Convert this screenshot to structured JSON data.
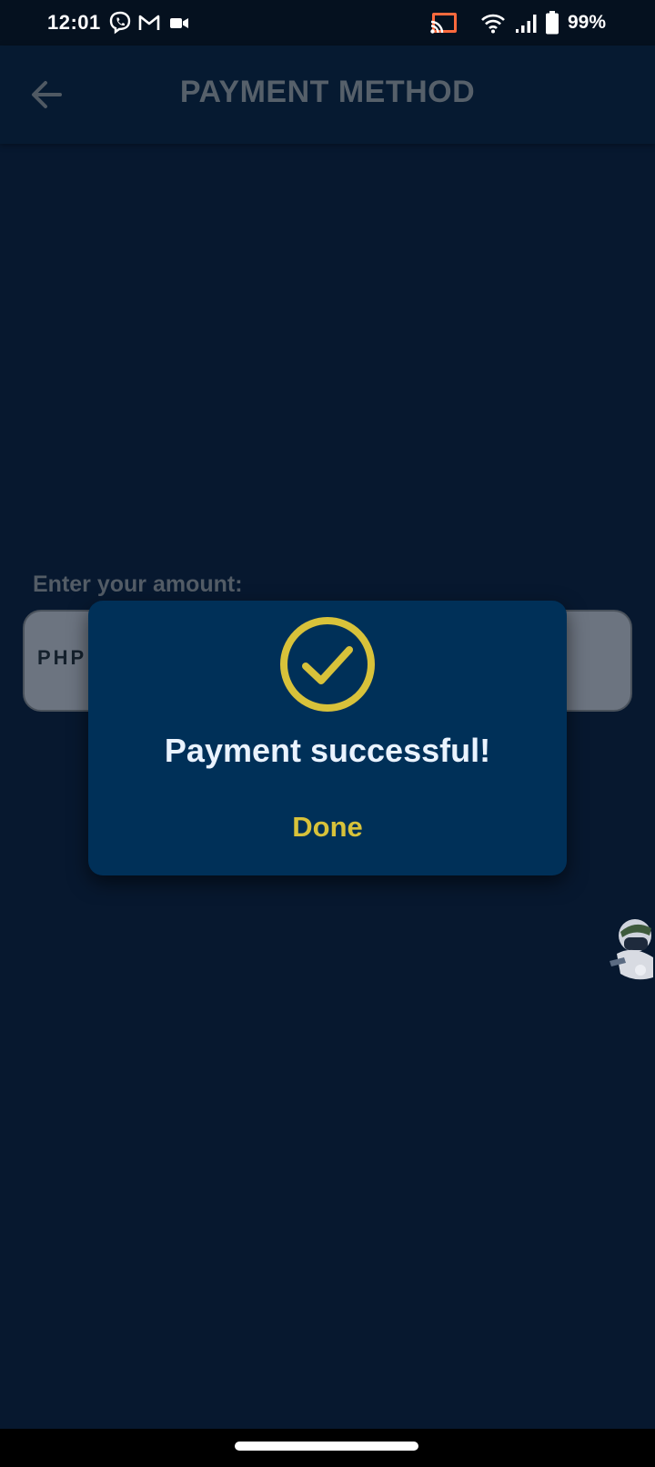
{
  "status_bar": {
    "time": "12:01",
    "battery": "99%",
    "icons": [
      "viber-icon",
      "gmail-icon",
      "video-camera-icon",
      "cast-icon",
      "wifi-icon",
      "signal-icon",
      "battery-icon"
    ]
  },
  "app_bar": {
    "title": "PAYMENT METHOD",
    "back_icon": "arrow-left-icon"
  },
  "amount": {
    "label": "Enter your amount:",
    "currency": "PHP"
  },
  "dialog": {
    "icon": "check-circle-icon",
    "message": "Payment successful!",
    "done_label": "Done"
  },
  "colors": {
    "background": "#07182f",
    "dialog": "#003058",
    "accent": "#d8c23a",
    "cast_accent": "#ff6a3d"
  }
}
